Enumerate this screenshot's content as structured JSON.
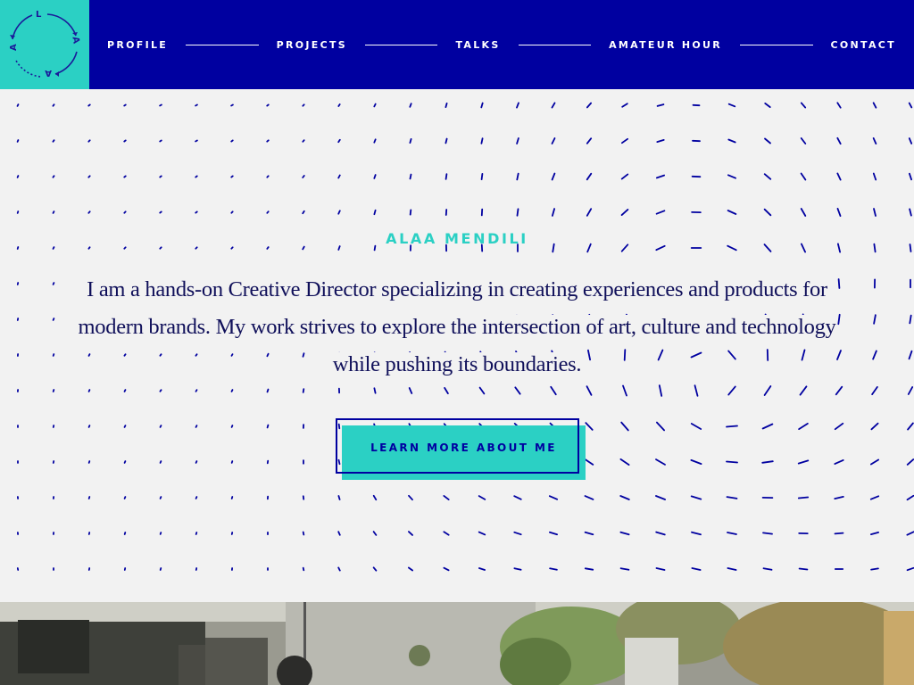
{
  "header": {
    "logo_letters": [
      "L",
      "A",
      "A",
      "A"
    ],
    "nav": [
      {
        "label": "PROFILE"
      },
      {
        "label": "PROJECTS"
      },
      {
        "label": "TALKS"
      },
      {
        "label": "AMATEUR HOUR"
      },
      {
        "label": "CONTACT"
      }
    ]
  },
  "hero": {
    "name": "ALAA MENDILI",
    "intro": "I am a hands-on Creative Director specializing in creating experiences and products for modern brands. My work strives to explore the intersection of art, culture and technology while pushing its boundaries.",
    "cta_label": "LEARN MORE ABOUT ME"
  },
  "colors": {
    "primary_blue": "#0000a0",
    "accent_teal": "#2bd0c4",
    "background": "#f2f2f2",
    "text_dark": "#10105a"
  },
  "icons": {
    "logo": "circular-arrows-logo-icon",
    "pattern": "dash-flow-field-pattern"
  }
}
